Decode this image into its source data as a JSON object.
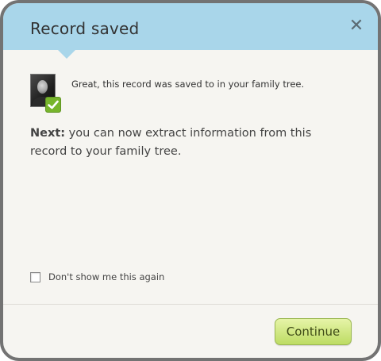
{
  "dialog": {
    "title": "Record saved",
    "close_icon": "close-icon",
    "close_glyph": "✕",
    "saved_message": "Great, this record was saved to in your family tree.",
    "next_label": "Next:",
    "next_body": " you can now extract information from this record to your family tree.",
    "dont_show_label": "Don't show me this again",
    "dont_show_checked": false,
    "continue_label": "Continue"
  },
  "colors": {
    "header": "#a9d6ea",
    "frame_border": "#737373",
    "body": "#f6f5f1",
    "check_badge": "#77b52c",
    "continue_top": "#e6f4a8",
    "continue_bottom": "#bddc63"
  },
  "icons": {
    "record_thumbnail": "person-portrait-icon",
    "saved_check": "checkmark-badge-icon"
  }
}
